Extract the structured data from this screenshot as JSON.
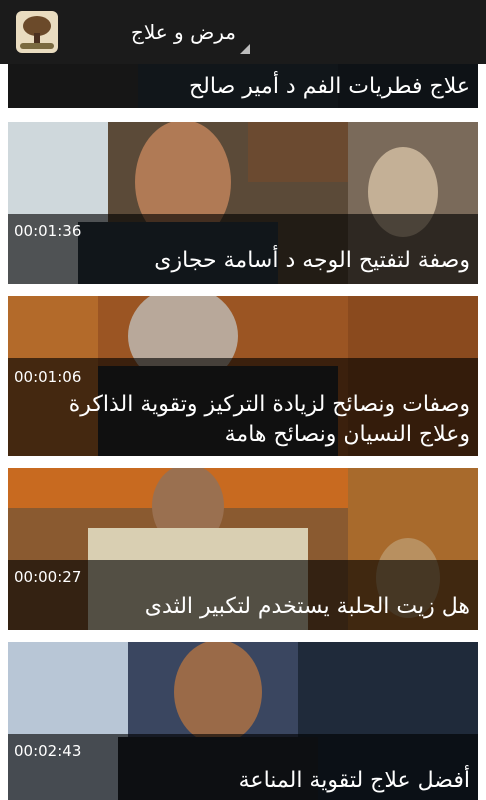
{
  "app": {
    "title": "مرض و علاج"
  },
  "videos": [
    {
      "title": "علاج فطريات الفم د أمير صالح",
      "duration": ""
    },
    {
      "title": "وصفة لتفتيح الوجه د أسامة حجازى",
      "duration": "00:01:36"
    },
    {
      "title": "وصفات ونصائح لزيادة التركيز وتقوية الذاكرة وعلاج النسيان ونصائح هامة",
      "duration": "00:01:06"
    },
    {
      "title": "هل زيت الحلبة يستخدم لتكبير الثدى",
      "duration": "00:00:27"
    },
    {
      "title": "أفضل علاج لتقوية المناعة",
      "duration": "00:02:43"
    }
  ],
  "colors": {
    "appbar": "#1b1b1b",
    "overlay": "#000000",
    "text": "#ffffff"
  }
}
